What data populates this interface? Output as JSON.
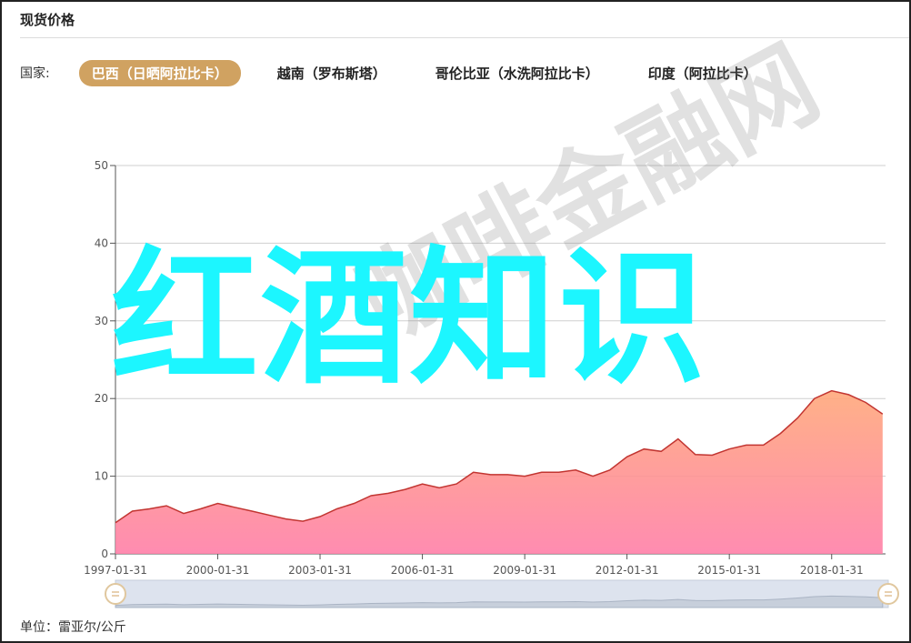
{
  "header": {
    "title": "现货价格"
  },
  "filter": {
    "label": "国家:",
    "tabs": [
      {
        "label": "巴西（日晒阿拉比卡）",
        "active": true
      },
      {
        "label": "越南（罗布斯塔）",
        "active": false
      },
      {
        "label": "哥伦比亚（水洗阿拉比卡）",
        "active": false
      },
      {
        "label": "印度（阿拉比卡）",
        "active": false
      }
    ]
  },
  "footer": {
    "unit": "单位：雷亚尔/公斤"
  },
  "overlay": {
    "big_text": "红酒知识",
    "watermark_text": "咖啡金融网"
  },
  "colors": {
    "accent": "#d0a261",
    "line": "#c23531",
    "area_top": "#ffa87a",
    "area_bottom": "#ff7fa8",
    "overlay": "#1cf6ff"
  },
  "chart_data": {
    "type": "area",
    "ylim": [
      0,
      50
    ],
    "yticks": [
      0,
      10,
      20,
      30,
      40,
      50
    ],
    "xlim": [
      "1997-01-31",
      "2019-08-31"
    ],
    "xticks": [
      "1997-01-31",
      "2000-01-31",
      "2003-01-31",
      "2006-01-31",
      "2009-01-31",
      "2012-01-31",
      "2015-01-31",
      "2018-01-31"
    ],
    "grid": true,
    "has_zoom_slider": true,
    "x": [
      "1997-01-31",
      "1997-07-31",
      "1998-01-31",
      "1998-07-31",
      "1999-01-31",
      "1999-07-31",
      "2000-01-31",
      "2000-07-31",
      "2001-01-31",
      "2001-07-31",
      "2002-01-31",
      "2002-07-31",
      "2003-01-31",
      "2003-07-31",
      "2004-01-31",
      "2004-07-31",
      "2005-01-31",
      "2005-07-31",
      "2006-01-31",
      "2006-07-31",
      "2007-01-31",
      "2007-07-31",
      "2008-01-31",
      "2008-07-31",
      "2009-01-31",
      "2009-07-31",
      "2010-01-31",
      "2010-07-31",
      "2011-01-31",
      "2011-07-31",
      "2012-01-31",
      "2012-07-31",
      "2013-01-31",
      "2013-07-31",
      "2014-01-31",
      "2014-07-31",
      "2015-01-31",
      "2015-07-31",
      "2016-01-31",
      "2016-07-31",
      "2017-01-31",
      "2017-07-31",
      "2018-01-31",
      "2018-07-31",
      "2019-01-31",
      "2019-07-31"
    ],
    "values": [
      4.0,
      5.5,
      5.8,
      6.2,
      5.2,
      5.8,
      6.5,
      6.0,
      5.5,
      5.0,
      4.5,
      4.2,
      4.8,
      5.8,
      6.5,
      7.5,
      7.8,
      8.3,
      9.0,
      8.5,
      9.0,
      10.5,
      10.2,
      10.2,
      10.0,
      10.5,
      10.5,
      10.8,
      10.0,
      10.8,
      12.5,
      13.5,
      13.2,
      14.8,
      12.8,
      12.7,
      13.5,
      14.0,
      14.0,
      15.5,
      17.5,
      20.0,
      21.0,
      20.5,
      19.5,
      18.0
    ]
  }
}
